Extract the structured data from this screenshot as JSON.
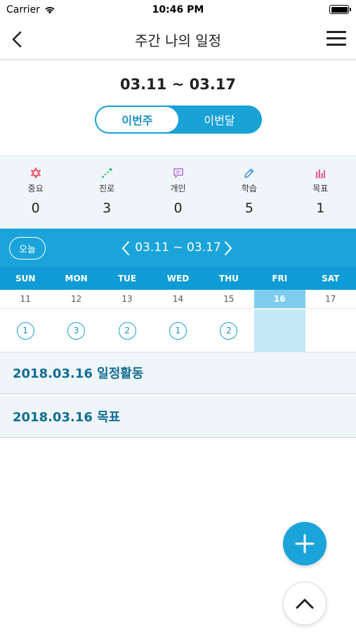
{
  "status": {
    "carrier": "Carrier",
    "time": "10:46 PM",
    "icons": [
      "wifi-icon",
      "battery-icon"
    ]
  },
  "nav": {
    "title": "주간 나의 일정",
    "back_icon": "chevron-left-icon",
    "menu_icon": "hamburger-menu-icon"
  },
  "range": {
    "title": "03.11 ~ 03.17",
    "tabs": [
      {
        "label": "이번주",
        "active": true
      },
      {
        "label": "이번달",
        "active": false
      }
    ]
  },
  "categories": [
    {
      "label": "중요",
      "count": "0",
      "icon": "star-of-david-icon",
      "color": "#e85a6a"
    },
    {
      "label": "진로",
      "count": "3",
      "icon": "path-dots-icon",
      "color": "#4cc38a"
    },
    {
      "label": "개인",
      "count": "0",
      "icon": "speech-bubble-icon",
      "color": "#b46fd6"
    },
    {
      "label": "학습",
      "count": "5",
      "icon": "pencil-icon",
      "color": "#3f8fd9"
    },
    {
      "label": "목표",
      "count": "1",
      "icon": "bar-chart-icon",
      "color": "#e85a9a"
    }
  ],
  "calendar": {
    "today_label": "오늘",
    "range": "03.11 ~ 03.17",
    "prev_icon": "chevron-left-icon",
    "next_icon": "chevron-right-icon",
    "days": [
      {
        "dow": "SUN",
        "date": "11",
        "count": "1"
      },
      {
        "dow": "MON",
        "date": "12",
        "count": "3"
      },
      {
        "dow": "TUE",
        "date": "13",
        "count": "2"
      },
      {
        "dow": "WED",
        "date": "14",
        "count": "1"
      },
      {
        "dow": "THU",
        "date": "15",
        "count": "2"
      },
      {
        "dow": "FRI",
        "date": "16",
        "count": "",
        "selected": true
      },
      {
        "dow": "SAT",
        "date": "17",
        "count": ""
      }
    ]
  },
  "sections": [
    {
      "label": "2018.03.16 일정활동"
    },
    {
      "label": "2018.03.16 목표"
    }
  ],
  "fab": {
    "add_icon": "plus-icon",
    "up_icon": "chevron-up-icon"
  },
  "colors": {
    "accent": "#1aa4d9",
    "accent_dark": "#0f9cd6",
    "section_text": "#126c94",
    "panel_bg": "#eef6f9"
  }
}
